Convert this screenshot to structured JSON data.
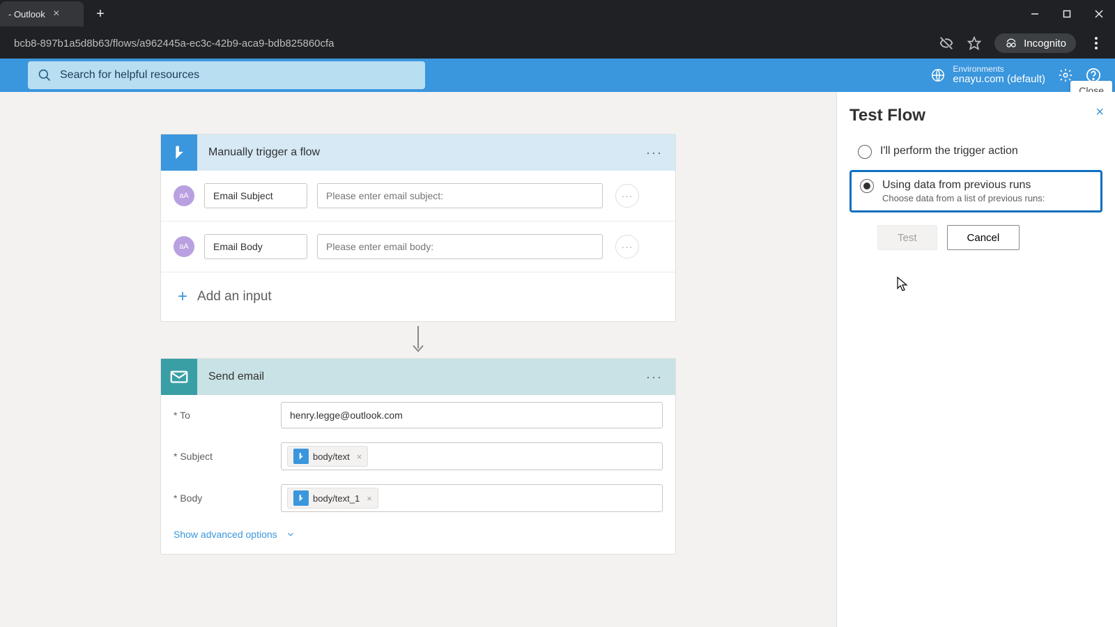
{
  "browser": {
    "tab_title": "- Outlook",
    "url_fragment": "bcb8-897b1a5d8b63/flows/a962445a-ec3c-42b9-aca9-bdb825860cfa",
    "incognito_label": "Incognito"
  },
  "header": {
    "search_placeholder": "Search for helpful resources",
    "env_label": "Environments",
    "env_name": "enayu.com (default)",
    "close_tooltip": "Close"
  },
  "trigger_card": {
    "title": "Manually trigger a flow",
    "params": [
      {
        "avatar": "aA",
        "label": "Email Subject",
        "placeholder": "Please enter email subject:"
      },
      {
        "avatar": "aA",
        "label": "Email Body",
        "placeholder": "Please enter email body:"
      }
    ],
    "add_input": "Add an input"
  },
  "action_card": {
    "title": "Send email",
    "fields": {
      "to_label": "* To",
      "to_value": "henry.legge@outlook.com",
      "subject_label": "* Subject",
      "subject_token": "body/text",
      "body_label": "* Body",
      "body_token": "body/text_1"
    },
    "show_advanced": "Show advanced options"
  },
  "panel": {
    "title": "Test Flow",
    "option1": "I'll perform the trigger action",
    "option2": "Using data from previous runs",
    "option2_sub": "Choose data from a list of previous runs:",
    "test_btn": "Test",
    "cancel_btn": "Cancel"
  }
}
